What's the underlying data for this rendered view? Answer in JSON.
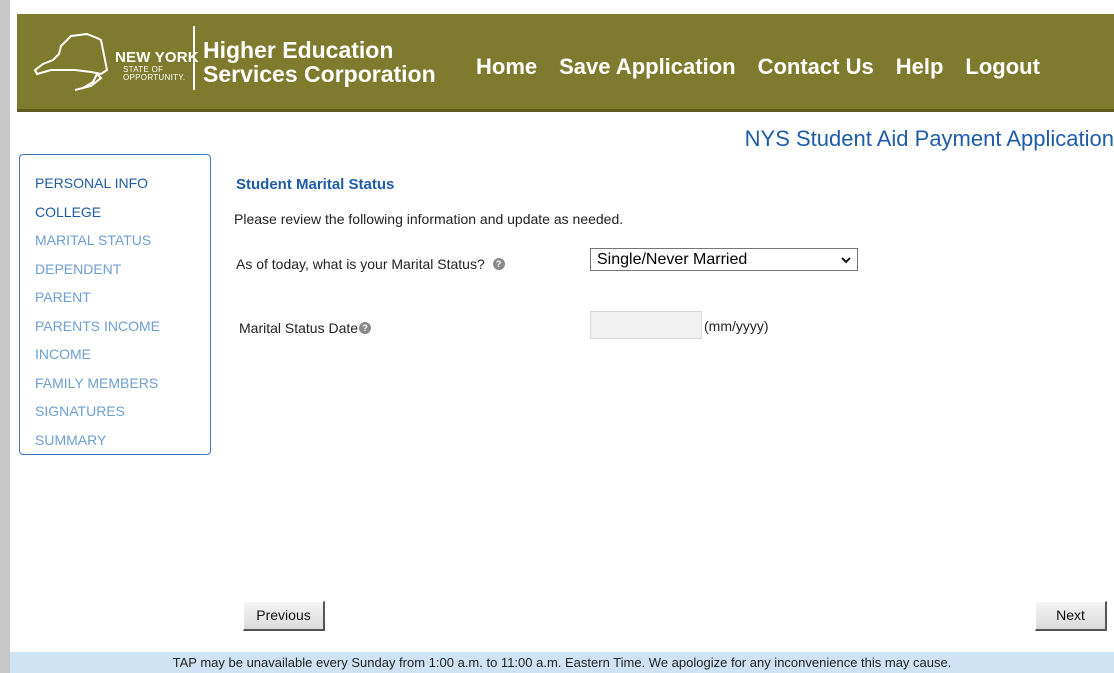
{
  "header": {
    "logo": {
      "line1": "NEW YORK",
      "line2": "STATE OF",
      "line3": "OPPORTUNITY."
    },
    "org_name_line1": "Higher Education",
    "org_name_line2": "Services Corporation",
    "nav": [
      {
        "label": "Home"
      },
      {
        "label": "Save Application"
      },
      {
        "label": "Contact Us"
      },
      {
        "label": "Help"
      },
      {
        "label": "Logout"
      }
    ],
    "bg_color": "#7f7b2e"
  },
  "app_title": "NYS Student Aid Payment Application",
  "sidebar": {
    "items": [
      {
        "label": "PERSONAL INFO"
      },
      {
        "label": "COLLEGE"
      },
      {
        "label": "MARITAL STATUS"
      },
      {
        "label": "DEPENDENT"
      },
      {
        "label": "PARENT"
      },
      {
        "label": "PARENTS INCOME"
      },
      {
        "label": "INCOME"
      },
      {
        "label": "FAMILY MEMBERS"
      },
      {
        "label": "SIGNATURES"
      },
      {
        "label": "SUMMARY"
      }
    ]
  },
  "form": {
    "section_title": "Student Marital Status",
    "intro": "Please review the following information and update as needed.",
    "marital_question": "As of today, what is your Marital Status?",
    "marital_value": "Single/Never Married",
    "date_label": "Marital Status Date",
    "date_value": "",
    "date_format": "(mm/yyyy)",
    "help_icon": "question-circle-icon"
  },
  "buttons": {
    "previous": "Previous",
    "next": "Next"
  },
  "footer": {
    "notice": "TAP may be unavailable every Sunday from 1:00 a.m. to 11:00 a.m. Eastern Time. We apologize for any inconvenience this may cause."
  }
}
